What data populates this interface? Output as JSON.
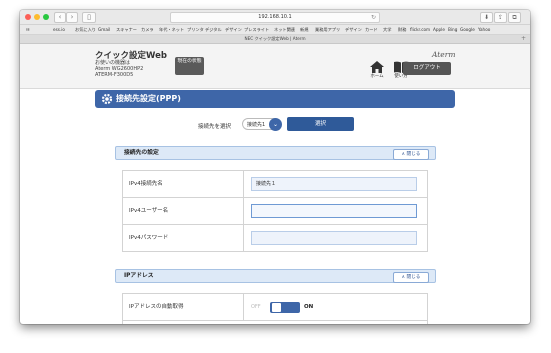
{
  "browser": {
    "address": "192.168.10.1",
    "tab_title": "NEC クイック設定Web | Aterm",
    "bookmarks": [
      "ess.io",
      "お気に入り",
      "Gmail",
      "スキャナー",
      "カメラ",
      "年代・ネット",
      "プリンタ",
      "デジタル",
      "デザイン",
      "プレスライト",
      "ネット関連",
      "新規",
      "業務用アプリ",
      "デザイン",
      "カード",
      "大学",
      "財務",
      "flickr.com",
      "Apple",
      "Bing",
      "Google",
      "Yahoo"
    ]
  },
  "header": {
    "site_title": "クイック設定Web",
    "device_label": "お使いの機器は",
    "device_model": "Aterm WG2600HP2",
    "device_model2": "ATERM-F300D5",
    "status_button": "現在の状態",
    "brand": "Aterm",
    "home_label": "ホーム",
    "help_label": "使い方",
    "logout_label": "ログアウト"
  },
  "main": {
    "title": "接続先設定(PPP)",
    "select_label": "接続先を選択",
    "select_value": "接続先1",
    "select_button": "選択"
  },
  "sections": [
    {
      "title": "接続先の設定",
      "close_label": "閉じる",
      "rows": [
        {
          "label": "IPv4接続先名",
          "value": "接続先１"
        },
        {
          "label": "IPv4ユーザー名",
          "value": ""
        },
        {
          "label": "IPv4パスワード",
          "value": ""
        }
      ]
    },
    {
      "title": "IPアドレス",
      "close_label": "閉じる",
      "rows": [
        {
          "label": "IPアドレスの自動取得",
          "off_label": "OFF",
          "on_label": "ON",
          "state": "on"
        }
      ]
    }
  ],
  "colors": {
    "accent": "#3e66a8",
    "banner": "#3e66a8",
    "group_header": "#dde9f7"
  }
}
